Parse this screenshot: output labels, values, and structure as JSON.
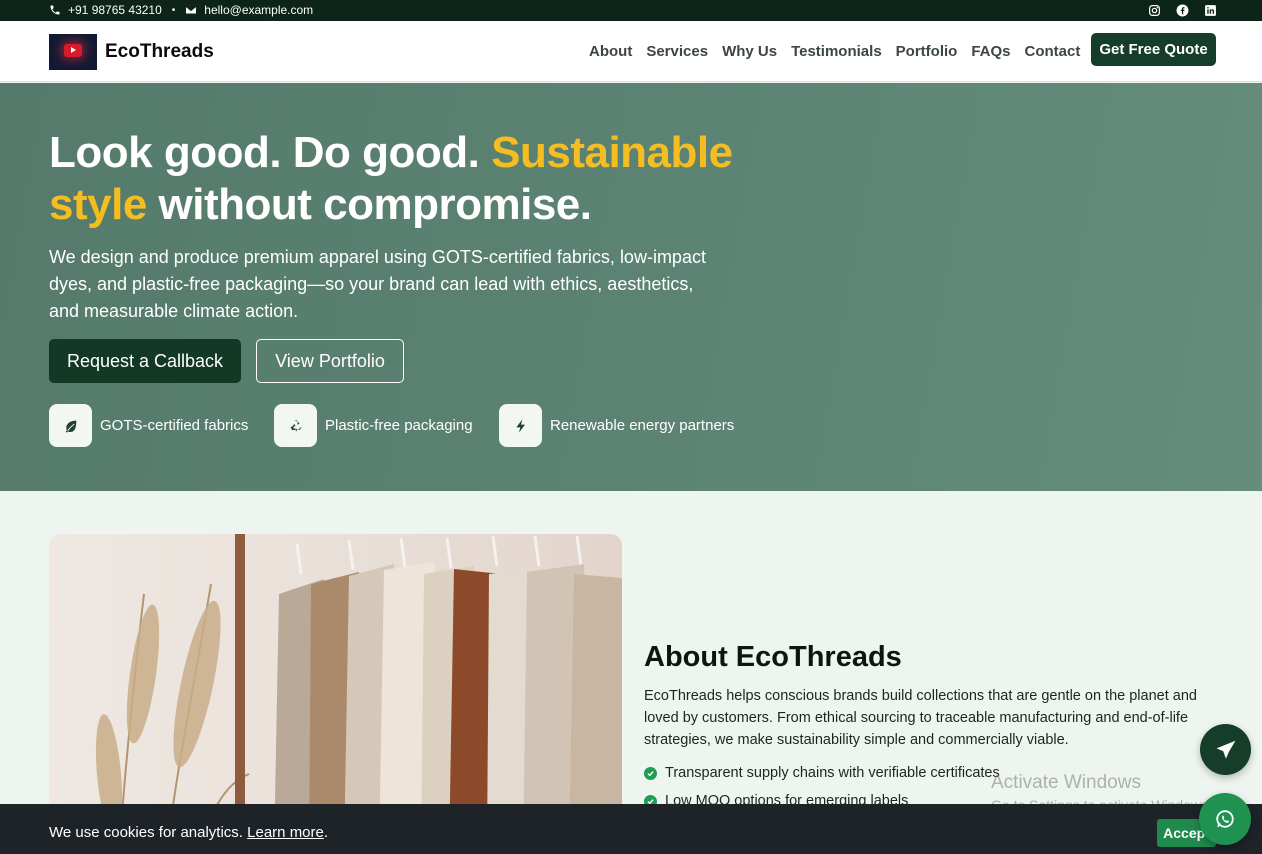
{
  "topbar": {
    "phone": "+91 98765 43210",
    "separator": "•",
    "email": "hello@example.com",
    "socials": [
      "instagram-icon",
      "facebook-icon",
      "linkedin-icon"
    ]
  },
  "nav": {
    "brand": "EcoThreads",
    "links": [
      "About",
      "Services",
      "Why Us",
      "Testimonials",
      "Portfolio",
      "FAQs",
      "Contact"
    ],
    "cta": "Get Free Quote"
  },
  "hero": {
    "title_part1": "Look good. Do good. ",
    "title_highlight": "Sustainable style",
    "title_part2": " without compromise.",
    "description": "We design and produce premium apparel using GOTS-certified fabrics, low-impact dyes, and plastic-free packaging—so your brand can lead with ethics, aesthetics, and measurable climate action.",
    "primary_button": "Request a Callback",
    "secondary_button": "View Portfolio",
    "features": [
      {
        "icon": "leaf-icon",
        "label": "GOTS-certified fabrics"
      },
      {
        "icon": "recycle-icon",
        "label": "Plastic-free packaging"
      },
      {
        "icon": "bolt-icon",
        "label": "Renewable energy partners"
      }
    ]
  },
  "about": {
    "title": "About EcoThreads",
    "text": "EcoThreads helps conscious brands build collections that are gentle on the planet and loved by customers. From ethical sourcing to traceable manufacturing and end-of-life strategies, we make sustainability simple and commercially viable.",
    "bullets": [
      "Transparent supply chains with verifiable certificates",
      "Low MOQ options for emerging labels"
    ]
  },
  "watermark": {
    "title": "Activate Windows",
    "subtitle": "Go to Settings to activate Windows."
  },
  "cookie": {
    "message": "We use cookies for analytics. ",
    "link": "Learn more",
    "suffix": ".",
    "accept": "Accept"
  },
  "colors": {
    "dark_green": "#163d2a",
    "hero_bg": "#5b8272",
    "highlight": "#f5bd21",
    "topbar_bg": "#0d2418",
    "cookie_bg": "#1e2328",
    "whatsapp": "#1f9150"
  }
}
